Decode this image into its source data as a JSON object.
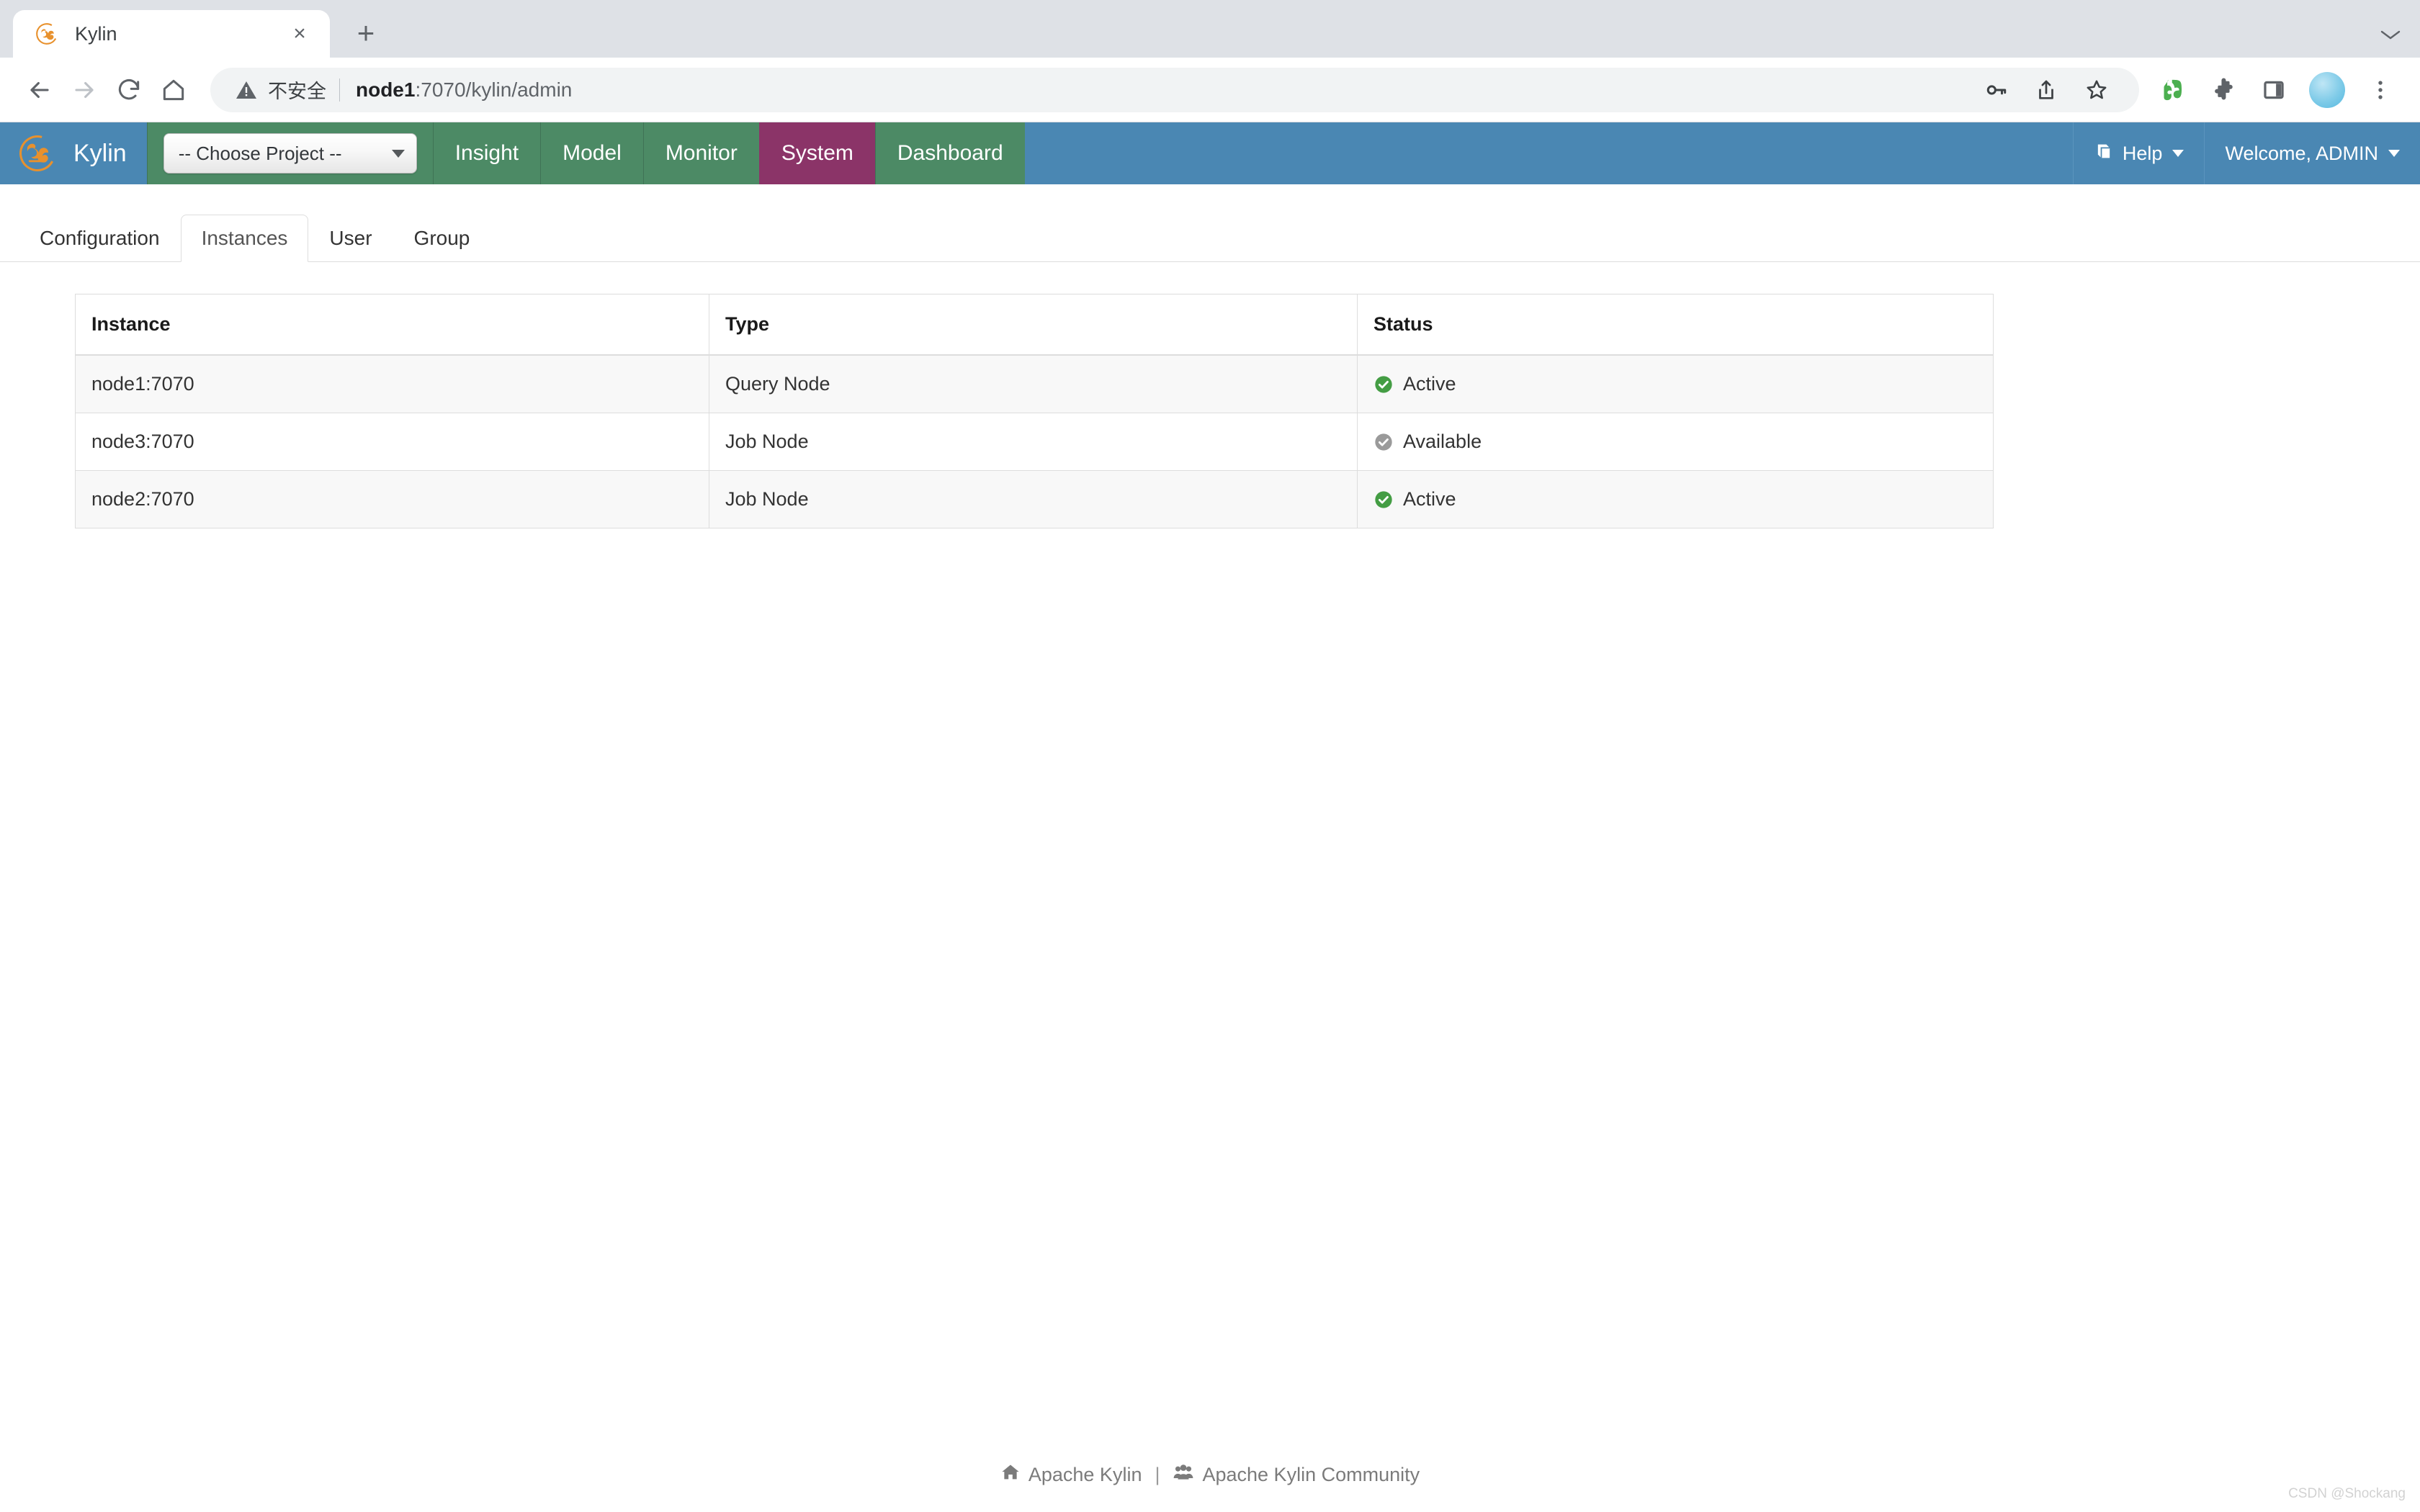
{
  "browser": {
    "tab": {
      "title": "Kylin",
      "favicon": "kylin-favicon",
      "close": "×"
    },
    "new_tab": "+",
    "tabstrip_menu": "⌄",
    "nav": {
      "back": "back-icon",
      "forward": "forward-icon",
      "reload": "reload-icon",
      "home": "home-icon"
    },
    "omnibox": {
      "security_warning": "不安全",
      "url_bold": "node1",
      "url_rest": ":7070/kylin/admin",
      "full_url": "node1:7070/kylin/admin"
    },
    "actions": [
      "key-icon",
      "share-icon",
      "bookmark-star-icon"
    ],
    "extensions": [
      "evernote-icon",
      "puzzle-extensions-icon",
      "side-panel-icon"
    ],
    "profile": "avatar",
    "menu": "three-dot-menu-icon"
  },
  "kylin": {
    "brand": {
      "logo": "kylin-logo",
      "name": "Kylin"
    },
    "project_select": {
      "value": "-- Choose Project --",
      "caret": "chevron-down-icon"
    },
    "nav_items": [
      {
        "label": "Insight",
        "active": false
      },
      {
        "label": "Model",
        "active": false
      },
      {
        "label": "Monitor",
        "active": false
      },
      {
        "label": "System",
        "active": true
      },
      {
        "label": "Dashboard",
        "active": false
      }
    ],
    "help": {
      "label": "Help",
      "icon": "book-icon"
    },
    "user": {
      "label": "Welcome, ADMIN",
      "caret": "chevron-down-icon"
    },
    "colors": {
      "brand_blue": "#4a87b3",
      "nav_green": "#4c8a65",
      "active_purple": "#8b3468",
      "status_active": "#449d44",
      "status_available": "#9a9a9a"
    }
  },
  "subtabs": [
    {
      "label": "Configuration",
      "active": false
    },
    {
      "label": "Instances",
      "active": true
    },
    {
      "label": "User",
      "active": false
    },
    {
      "label": "Group",
      "active": false
    }
  ],
  "table": {
    "columns": [
      "Instance",
      "Type",
      "Status"
    ],
    "rows": [
      {
        "instance": "node1:7070",
        "type": "Query Node",
        "status": "Active",
        "status_state": "active"
      },
      {
        "instance": "node3:7070",
        "type": "Job Node",
        "status": "Available",
        "status_state": "available"
      },
      {
        "instance": "node2:7070",
        "type": "Job Node",
        "status": "Active",
        "status_state": "active"
      }
    ]
  },
  "footer": {
    "home_link": "Apache Kylin",
    "separator": "|",
    "community_link": "Apache Kylin Community"
  },
  "watermark": "CSDN @Shockang"
}
